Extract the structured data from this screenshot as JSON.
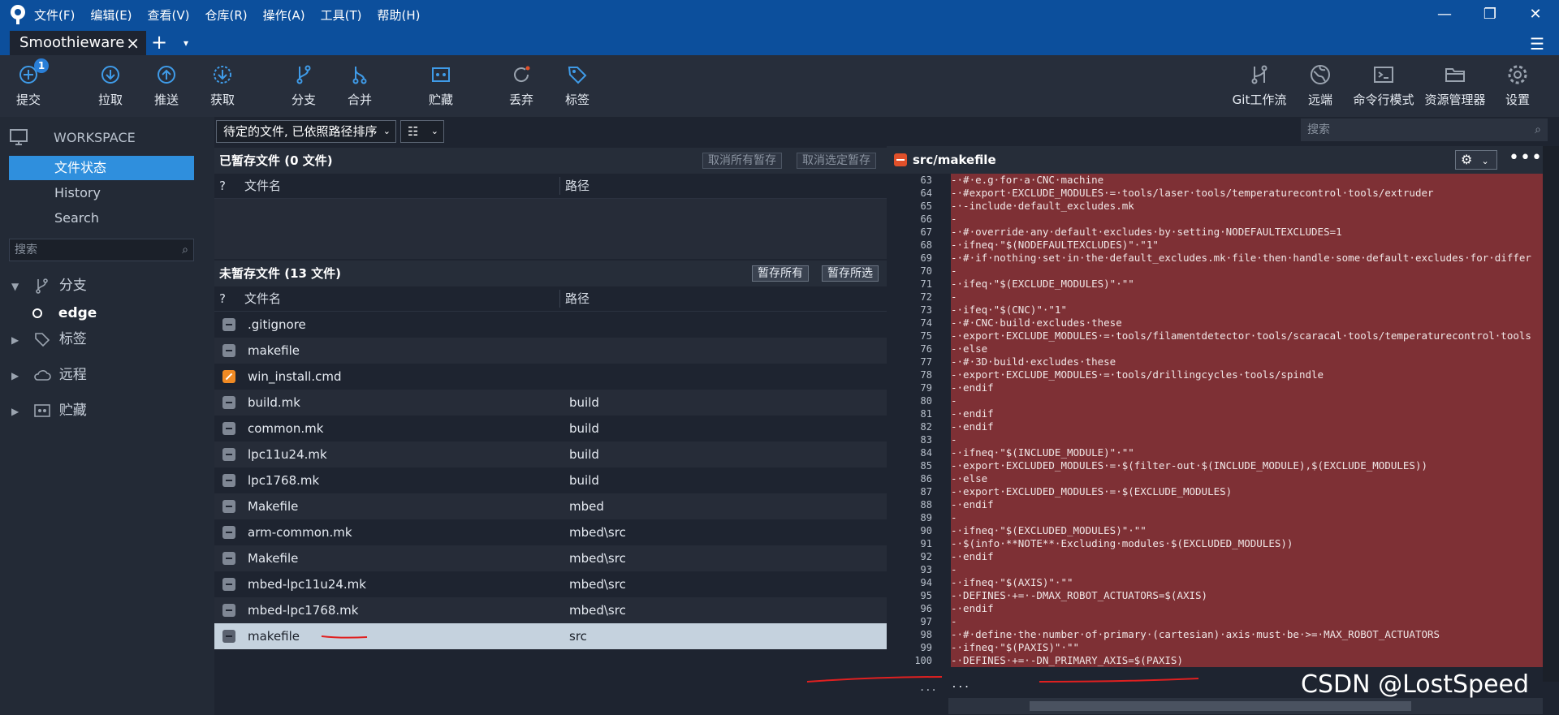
{
  "menu": [
    "文件(F)",
    "编辑(E)",
    "查看(V)",
    "仓库(R)",
    "操作(A)",
    "工具(T)",
    "帮助(H)"
  ],
  "window_icons": {
    "minimize": "minimize-icon",
    "restore": "restore-icon",
    "close": "close-icon"
  },
  "tab": {
    "repo_name": "Smoothieware",
    "close": "×",
    "add": "+",
    "dropdown": "▾",
    "menu": "☰"
  },
  "toolbar": {
    "commit": {
      "label": "提交",
      "badge": "1"
    },
    "pull": {
      "label": "拉取"
    },
    "push": {
      "label": "推送"
    },
    "fetch": {
      "label": "获取"
    },
    "branch": {
      "label": "分支"
    },
    "merge": {
      "label": "合并"
    },
    "stash": {
      "label": "贮藏"
    },
    "discard": {
      "label": "丢弃"
    },
    "tag": {
      "label": "标签"
    },
    "gitflow": {
      "label": "Git工作流"
    },
    "remote": {
      "label": "远端"
    },
    "terminal": {
      "label": "命令行模式"
    },
    "explorer": {
      "label": "资源管理器"
    },
    "settings": {
      "label": "设置"
    }
  },
  "sidebar": {
    "workspace": "WORKSPACE",
    "items": [
      "文件状态",
      "History",
      "Search"
    ],
    "search_placeholder": "搜索",
    "branches": "分支",
    "current_branch": "edge",
    "tags": "标签",
    "remotes": "远程",
    "stashes": "贮藏"
  },
  "center": {
    "sort_select": "待定的文件, 已依照路径排序",
    "view_select": "☷",
    "staged": {
      "title": "已暂存文件 (0 文件)",
      "unstage_all": "取消所有暂存",
      "unstage_selected": "取消选定暂存"
    },
    "unstaged": {
      "title": "未暂存文件 (13 文件)",
      "stage_all": "暂存所有",
      "stage_selected": "暂存所选"
    },
    "columns": {
      "status": "?",
      "name": "文件名",
      "path": "路径"
    },
    "files": [
      {
        "name": ".gitignore",
        "path": ""
      },
      {
        "name": "makefile",
        "path": ""
      },
      {
        "name": "win_install.cmd",
        "path": ""
      },
      {
        "name": "build.mk",
        "path": "build"
      },
      {
        "name": "common.mk",
        "path": "build"
      },
      {
        "name": "lpc11u24.mk",
        "path": "build"
      },
      {
        "name": "lpc1768.mk",
        "path": "build"
      },
      {
        "name": "Makefile",
        "path": "mbed"
      },
      {
        "name": "arm-common.mk",
        "path": "mbed\\src"
      },
      {
        "name": "Makefile",
        "path": "mbed\\src"
      },
      {
        "name": "mbed-lpc11u24.mk",
        "path": "mbed\\src"
      },
      {
        "name": "mbed-lpc1768.mk",
        "path": "mbed\\src"
      },
      {
        "name": "makefile",
        "path": "src"
      }
    ]
  },
  "right": {
    "search_placeholder": "搜索",
    "file_name": "src/makefile",
    "more": "•••",
    "lines": [
      {
        "n": "63",
        "t": "-·#·e.g·for·a·CNC·machine"
      },
      {
        "n": "64",
        "t": "-·#export·EXCLUDE_MODULES·=·tools/laser·tools/temperaturecontrol·tools/extruder"
      },
      {
        "n": "65",
        "t": "-·-include·default_excludes.mk"
      },
      {
        "n": "66",
        "t": "-"
      },
      {
        "n": "67",
        "t": "-·#·override·any·default·excludes·by·setting·NODEFAULTEXCLUDES=1"
      },
      {
        "n": "68",
        "t": "-·ifneq·\"$(NODEFAULTEXCLUDES)\"·\"1\""
      },
      {
        "n": "69",
        "t": "-·#·if·nothing·set·in·the·default_excludes.mk·file·then·handle·some·default·excludes·for·differ"
      },
      {
        "n": "70",
        "t": "-"
      },
      {
        "n": "71",
        "t": "-·ifeq·\"$(EXCLUDE_MODULES)\"·\"\""
      },
      {
        "n": "72",
        "t": "-"
      },
      {
        "n": "73",
        "t": "-·ifeq·\"$(CNC)\"·\"1\""
      },
      {
        "n": "74",
        "t": "-·#·CNC·build·excludes·these"
      },
      {
        "n": "75",
        "t": "-·export·EXCLUDE_MODULES·=·tools/filamentdetector·tools/scaracal·tools/temperaturecontrol·tools"
      },
      {
        "n": "76",
        "t": "-·else"
      },
      {
        "n": "77",
        "t": "-·#·3D·build·excludes·these"
      },
      {
        "n": "78",
        "t": "-·export·EXCLUDE_MODULES·=·tools/drillingcycles·tools/spindle"
      },
      {
        "n": "79",
        "t": "-·endif"
      },
      {
        "n": "80",
        "t": "-"
      },
      {
        "n": "81",
        "t": "-·endif"
      },
      {
        "n": "82",
        "t": "-·endif"
      },
      {
        "n": "83",
        "t": "-"
      },
      {
        "n": "84",
        "t": "-·ifneq·\"$(INCLUDE_MODULE)\"·\"\""
      },
      {
        "n": "85",
        "t": "-·export·EXCLUDED_MODULES·=·$(filter-out·$(INCLUDE_MODULE),$(EXCLUDE_MODULES))"
      },
      {
        "n": "86",
        "t": "-·else"
      },
      {
        "n": "87",
        "t": "-·export·EXCLUDED_MODULES·=·$(EXCLUDE_MODULES)"
      },
      {
        "n": "88",
        "t": "-·endif"
      },
      {
        "n": "89",
        "t": "-"
      },
      {
        "n": "90",
        "t": "-·ifneq·\"$(EXCLUDED_MODULES)\"·\"\""
      },
      {
        "n": "91",
        "t": "-·$(info·**NOTE**·Excluding·modules·$(EXCLUDED_MODULES))"
      },
      {
        "n": "92",
        "t": "-·endif"
      },
      {
        "n": "93",
        "t": "-"
      },
      {
        "n": "94",
        "t": "-·ifneq·\"$(AXIS)\"·\"\""
      },
      {
        "n": "95",
        "t": "-·DEFINES·+=·-DMAX_ROBOT_ACTUATORS=$(AXIS)"
      },
      {
        "n": "96",
        "t": "-·endif"
      },
      {
        "n": "97",
        "t": "-"
      },
      {
        "n": "98",
        "t": "-·#·define·the·number·of·primary·(cartesian)·axis·must·be·>=·MAX_ROBOT_ACTUATORS"
      },
      {
        "n": "99",
        "t": "-·ifneq·\"$(PAXIS)\"·\"\""
      },
      {
        "n": "100",
        "t": "-·DEFINES·+=·-DN_PRIMARY_AXIS=$(PAXIS)"
      }
    ],
    "ellipsis_num": "...",
    "ellipsis_text": "...",
    "watermark": "CSDN @LostSpeed"
  }
}
